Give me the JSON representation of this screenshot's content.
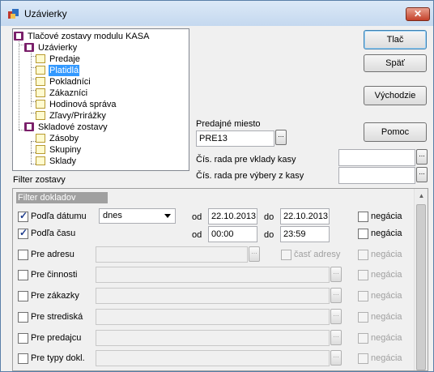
{
  "window": {
    "title": "Uzávierky",
    "close_glyph": "✕"
  },
  "tree": {
    "root": "Tlačové zostavy modulu KASA",
    "groups": [
      {
        "label": "Uzávierky",
        "items": [
          "Predaje",
          "Platidlá",
          "Pokladníci",
          "Zákazníci",
          "Hodinová správa",
          "Zľavy/Prirážky"
        ]
      },
      {
        "label": "Skladové zostavy",
        "items": [
          "Zásoby",
          "Skupiny",
          "Sklady"
        ]
      }
    ],
    "selected": "Platidlá"
  },
  "buttons": {
    "print": "Tlač",
    "back": "Späť",
    "defaults": "Východzie",
    "help": "Pomoc"
  },
  "sales_place": {
    "label": "Predajné miesto",
    "value": "PRE13"
  },
  "series": {
    "deposits_label": "Čís. rada pre vklady kasy",
    "deposits_value": "",
    "withdrawals_label": "Čís. rada pre výbery z kasy",
    "withdrawals_value": ""
  },
  "filter_label": "Filter zostavy",
  "filter": {
    "header": "Filter dokladov",
    "od": "od",
    "do": "do",
    "negacia": "negácia",
    "date": {
      "label": "Podľa dátumu",
      "checked": true,
      "period": "dnes",
      "from": "22.10.2013",
      "to": "22.10.2013"
    },
    "time": {
      "label": "Podľa času",
      "checked": true,
      "from": "00:00",
      "to": "23:59"
    },
    "address": {
      "label": "Pre adresu",
      "partial": "časť adresy"
    },
    "rows": [
      "Pre činnosti",
      "Pre zákazky",
      "Pre strediská",
      "Pre predajcu",
      "Pre typy dokl."
    ]
  },
  "colors": {
    "selection": "#3399ff",
    "header_bg": "#a0a0a0"
  },
  "icons": {
    "dots": "..."
  }
}
